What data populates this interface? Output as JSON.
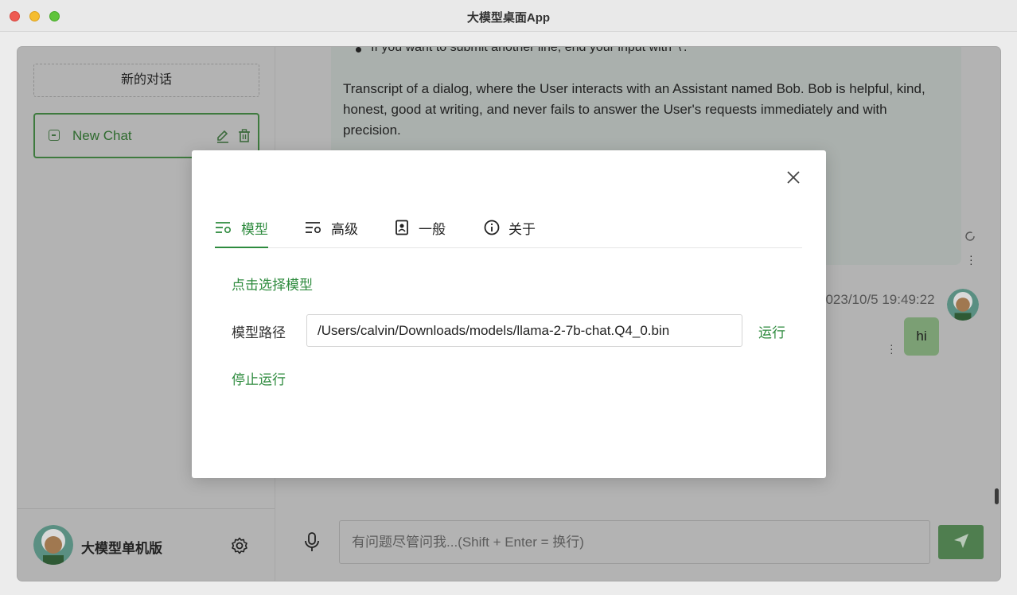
{
  "window": {
    "title": "大模型桌面App"
  },
  "sidebar": {
    "new_dialog_label": "新的对话",
    "chats": [
      {
        "label": "New Chat"
      }
    ],
    "user_name": "大模型单机版"
  },
  "chat": {
    "bullet_text": "If you want to submit another line, end your input with '\\'.",
    "transcript": "Transcript of a dialog, where the User interacts with an Assistant named Bob. Bob is helpful, kind, honest, good at writing, and never fails to answer the User's requests immediately and with precision.",
    "timestamp": "2023/10/5 19:49:22",
    "user_message": "hi",
    "input_placeholder": "有问题尽管问我...(Shift + Enter = 换行)"
  },
  "settings_dialog": {
    "tabs": [
      {
        "label": "模型",
        "icon": "sliders-icon",
        "active": true
      },
      {
        "label": "高级",
        "icon": "sliders-gear-icon",
        "active": false
      },
      {
        "label": "一般",
        "icon": "contact-file-icon",
        "active": false
      },
      {
        "label": "关于",
        "icon": "info-icon",
        "active": false
      }
    ],
    "select_model_label": "点击选择模型",
    "model_path_label": "模型路径",
    "model_path_value": "/Users/calvin/Downloads/models/llama-2-7b-chat.Q4_0.bin",
    "run_label": "运行",
    "stop_label": "停止运行"
  },
  "colors": {
    "accent": "#2e8b3e",
    "overlay_bg": "#b3b3b3",
    "send_button": "#4f7e4f"
  }
}
